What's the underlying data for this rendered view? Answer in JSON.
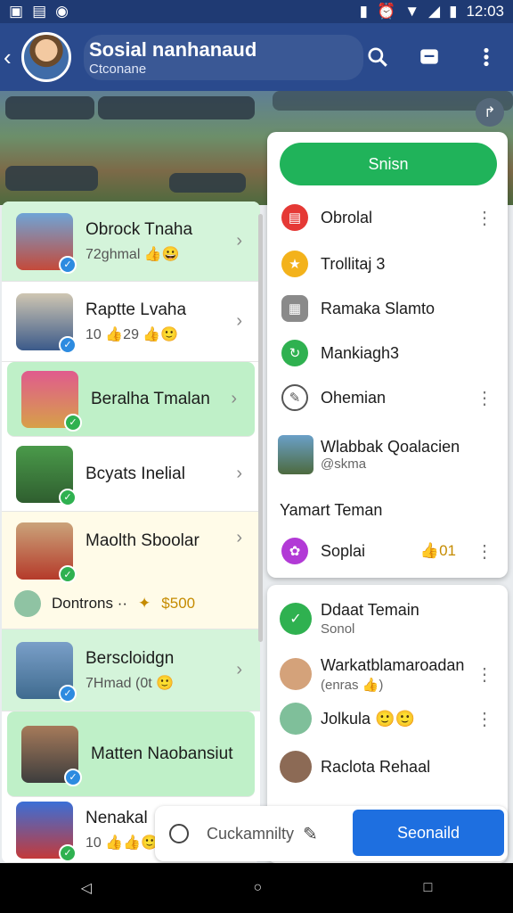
{
  "status": {
    "time": "12:03"
  },
  "header": {
    "title": "Sosial nanhanaud",
    "subtitle": "Ctconane"
  },
  "chats": [
    {
      "name": "Obrock Tnaha",
      "sub": "72ghmal 👍😀",
      "highlighted": true
    },
    {
      "name": "Raptte Lvaha",
      "sub": "10 👍29 👍🙂",
      "highlighted": false
    },
    {
      "name": "Beralha Tmalan",
      "sub": "",
      "highlighted": true
    },
    {
      "name": "Bcyats Inelial",
      "sub": "",
      "highlighted": false
    },
    {
      "name": "Maolth Sboolar",
      "sub": "",
      "highlighted": false
    },
    {
      "name": "Berscloidgn",
      "sub": "7Hmad (0t 🙂",
      "highlighted": true
    },
    {
      "name": "Matten Naobansiut",
      "sub": "",
      "highlighted": true
    },
    {
      "name": "Nenakal",
      "sub": "10 👍👍🙂",
      "highlighted": false
    }
  ],
  "coins": {
    "label": "Dontrons ··",
    "value": "$500"
  },
  "menu": {
    "sign_label": "Snisn",
    "items": [
      {
        "label": "Obrolal",
        "icon": "chat-icon",
        "color": "#e53935",
        "more": true
      },
      {
        "label": "Trollitaj 3",
        "icon": "trophy-icon",
        "color": "#f3b21b",
        "more": false
      },
      {
        "label": "Ramaka Slamto",
        "icon": "grid-icon",
        "color": "#8a8a8a",
        "more": false
      },
      {
        "label": "Mankiagh3",
        "icon": "refresh-icon",
        "color": "#2fb150",
        "more": false
      },
      {
        "label": "Ohemian",
        "icon": "edit-icon",
        "color": "#ffffff",
        "more": true
      }
    ],
    "profile": {
      "name": "Wlabbak Qoalacien",
      "sub": "@skma"
    },
    "section_title": "Yamart Teman",
    "social": {
      "label": "Soplai",
      "value": "👍01"
    }
  },
  "friends": [
    {
      "l1": "Ddaat Temain",
      "l2": "Sonol",
      "color": "#2fb150",
      "more": false
    },
    {
      "l1": "Warkatblamaroadan",
      "l2": "(enras 👍)",
      "color": "#d4a27a",
      "more": true
    },
    {
      "l1": "Jolkula 🙂🙂",
      "l2": "",
      "color": "#7fbf9a",
      "more": true
    },
    {
      "l1": "Raclota Rehaal",
      "l2": "",
      "color": "#8c6a55",
      "more": false
    }
  ],
  "compose": {
    "placeholder": "Cuckamnilty",
    "send_label": "Seonaild"
  },
  "colors": {
    "primary": "#2a4a8d",
    "accent_green": "#20b35a",
    "send_blue": "#1e6fe0"
  }
}
